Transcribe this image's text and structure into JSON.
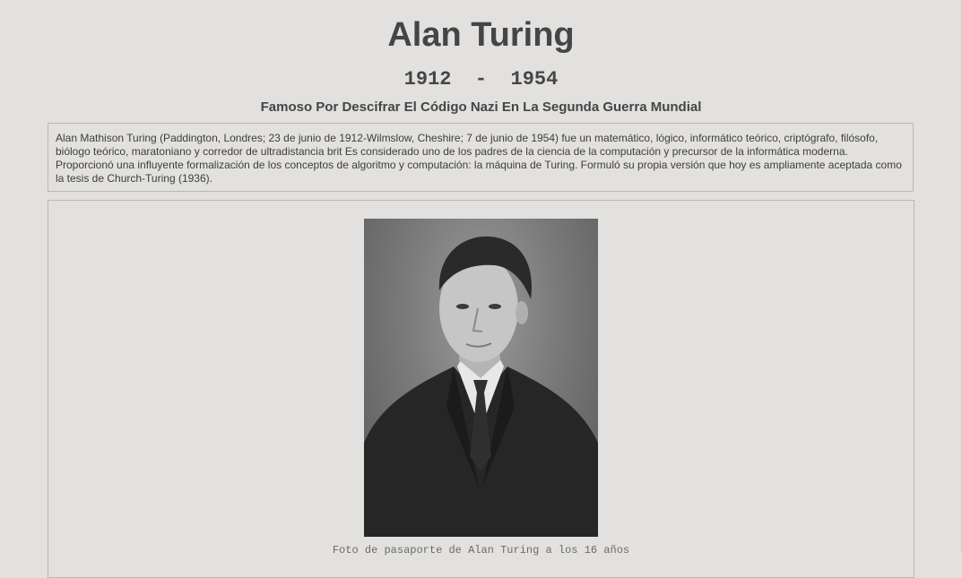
{
  "header": {
    "name": "Alan Turing",
    "dates": "1912  -  1954",
    "tagline": "Famoso Por Descifrar El Código Nazi En La Segunda Guerra Mundial"
  },
  "bio": {
    "text": "Alan Mathison Turing (Paddington, Londres; 23 de junio de 1912-Wilmslow, Cheshire; 7 de junio de 1954) fue un matemático, lógico, informático teórico, criptógrafo, filósofo, biólogo teórico, maratoniano y corredor de ultradistancia brit Es considerado uno de los padres de la ciencia de la computación y precursor de la informática moderna. Proporcionó una influyente formalización de los conceptos de algoritmo y computación: la máquina de Turing. Formuló su propia versión que hoy es ampliamente aceptada como la tesis de Church-Turing (1936)."
  },
  "figure": {
    "caption": "Foto de pasaporte de Alan Turing a los 16 años"
  },
  "colors": {
    "background": "#e2e1df",
    "text": "#454545",
    "border": "#b8b7b5"
  }
}
